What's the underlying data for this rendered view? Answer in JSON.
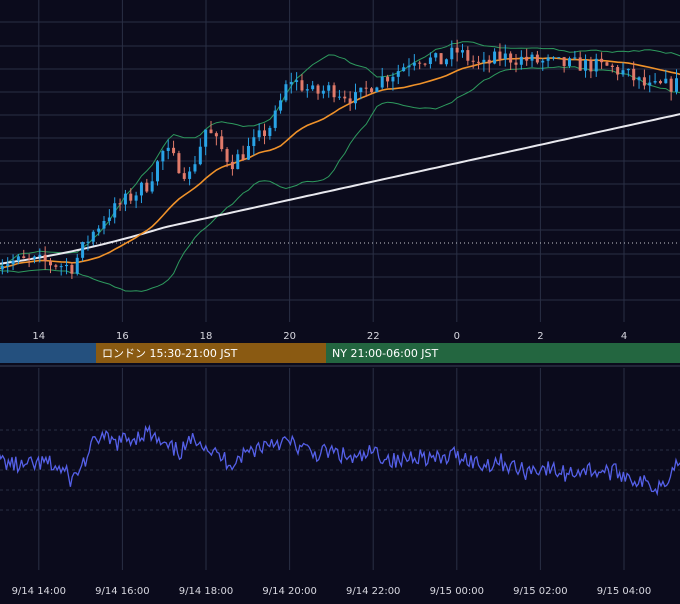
{
  "colors": {
    "background": "#0b0b1c",
    "grid": "#2a2f45",
    "candle_up": "#29a3e6",
    "candle_down": "#e07a6a",
    "ma_short": "#f0922a",
    "ma_long": "#e8e8ee",
    "bollinger": "#2e9a5e",
    "rsi_line": "#5560e8",
    "session_tokyo": "#24507e",
    "session_london": "#8a5a12",
    "session_ny": "#236640"
  },
  "top_axis_ticks": [
    "14",
    "16",
    "18",
    "20",
    "22",
    "0",
    "2",
    "4"
  ],
  "sessions": [
    {
      "id": "tokyo",
      "label": ""
    },
    {
      "id": "london",
      "label": "ロンドン 15:30-21:00 JST"
    },
    {
      "id": "ny",
      "label": "NY 21:00-06:00 JST"
    }
  ],
  "bottom_axis_ticks": [
    "9/14 14:00",
    "9/14 16:00",
    "9/14 18:00",
    "9/14 20:00",
    "9/14 22:00",
    "9/15 00:00",
    "9/15 02:00",
    "9/15 04:00"
  ],
  "chart_data": [
    {
      "type": "line",
      "subtype": "candlestick",
      "x_ticks": [
        "14",
        "16",
        "18",
        "20",
        "22",
        "0",
        "2",
        "4"
      ],
      "x_range_hours": [
        13.0,
        29.4
      ],
      "series": [
        {
          "kind": "price",
          "anchors_x": [
            13.0,
            14.0,
            14.8,
            15.2,
            15.6,
            16.0,
            16.6,
            17.0,
            17.6,
            18.0,
            18.6,
            19.0,
            19.6,
            20.0,
            20.6,
            21.0,
            21.6,
            22.0,
            22.6,
            23.0,
            23.6,
            24.0,
            24.6,
            25.0,
            25.6,
            26.0,
            26.6,
            27.0,
            27.6,
            28.0,
            28.6,
            29.0,
            29.4
          ],
          "anchors_y": [
            0.13,
            0.13,
            0.11,
            0.22,
            0.3,
            0.35,
            0.42,
            0.55,
            0.45,
            0.63,
            0.5,
            0.55,
            0.65,
            0.82,
            0.76,
            0.78,
            0.74,
            0.8,
            0.85,
            0.9,
            0.88,
            0.92,
            0.86,
            0.9,
            0.89,
            0.88,
            0.87,
            0.87,
            0.86,
            0.84,
            0.78,
            0.79,
            0.8
          ]
        },
        {
          "kind": "moving_average_short",
          "color": "#f0922a"
        },
        {
          "kind": "moving_average_long",
          "color": "#e8e8ee"
        },
        {
          "kind": "bollinger_bands",
          "color": "#2e9a5e"
        }
      ],
      "grid": true
    },
    {
      "type": "line",
      "subtype": "oscillator",
      "x_ticks": [
        "9/14 14:00",
        "9/14 16:00",
        "9/14 18:00",
        "9/14 20:00",
        "9/14 22:00",
        "9/15 00:00",
        "9/15 02:00",
        "9/15 04:00"
      ],
      "series": [
        {
          "kind": "oscillator",
          "color": "#5560e8",
          "anchors_x": [
            13.0,
            13.6,
            14.2,
            14.6,
            14.8,
            15.2,
            15.4,
            15.8,
            16.2,
            16.6,
            17.0,
            17.4,
            17.8,
            18.2,
            18.6,
            19.0,
            19.6,
            20.0,
            20.6,
            21.0,
            21.6,
            22.0,
            22.6,
            23.0,
            23.6,
            24.0,
            24.6,
            25.0,
            25.6,
            26.0,
            26.6,
            27.0,
            27.6,
            28.0,
            28.4,
            28.8,
            29.0,
            29.4
          ],
          "anchors_y": [
            0.55,
            0.48,
            0.52,
            0.44,
            0.36,
            0.6,
            0.76,
            0.7,
            0.74,
            0.8,
            0.66,
            0.62,
            0.76,
            0.6,
            0.52,
            0.62,
            0.72,
            0.7,
            0.6,
            0.62,
            0.54,
            0.62,
            0.52,
            0.6,
            0.54,
            0.6,
            0.5,
            0.54,
            0.44,
            0.48,
            0.42,
            0.46,
            0.44,
            0.42,
            0.34,
            0.3,
            0.38,
            0.58
          ]
        }
      ],
      "grid": true
    }
  ]
}
